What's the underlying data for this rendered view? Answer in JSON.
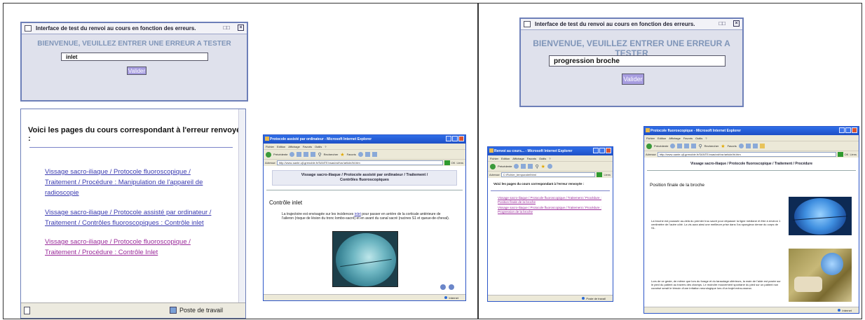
{
  "dialog": {
    "title": "Interface de test du renvoi au cours en fonction des erreurs.",
    "heading": "BIENVENUE, VEUILLEZ ENTRER UNE ERREUR A TESTER",
    "button": "Valider",
    "left_value": "inlet",
    "right_value": "progression broche"
  },
  "results": {
    "heading": "Voici les pages du cours correspondant à l'erreur renvoyée :",
    "links": [
      "Vissage sacro-iliaque / Protocole fluoroscopique / Traitement / Procédure : Manipulation de l'appareil de radioscopie",
      "Vissage sacro-iliaque / Protocole assisté par ordinateur / Traitement / Contrôles fluoroscopiques : Contrôle inlet",
      "Vissage sacro-iliaque / Protocole fluoroscopique / Traitement / Procédure : Contrôle Inlet"
    ],
    "status": "Poste de travail"
  },
  "ie_common": {
    "menu": [
      "Fichier",
      "Edition",
      "Affichage",
      "Favoris",
      "Outils",
      "?"
    ],
    "back": "Précédente",
    "search": "Rechercher",
    "favorites": "Favoris",
    "address_label": "Adresse",
    "go": "OK",
    "links": "Liens",
    "zone": "Internet"
  },
  "ie_inlet": {
    "title": "Protocole assisté par ordinateur - Microsoft Internet Explorer",
    "url": "http://www-sante.ujf-grenoble.fr/SANTE/vsas/vsf/vsr/article/bt.htm",
    "crumb": "Vissage sacro-iliaque / Protocole assisté par ordinateur / Traitement / Contrôles fluoroscopiques",
    "heading": "Contrôle inlet",
    "text_before": "La trajectoire est envisagée sur les incidences ",
    "text_link": "inlet",
    "text_after": " pour passer en arrière de la corticale antérieure de l'aileron (risque de lésion du tronc lombo-sacré) et en avant du canal sacré (racines S1 et queue-de-cheval)."
  },
  "ie_small": {
    "title": "Renvoi au cours... - Microsoft Internet Explorer",
    "url": "C:\\Fichier_temporaire\\html",
    "heading": "Voici les pages du cours correspondant à l'erreur renvoyée :",
    "link": "Vissage sacro-iliaque / Protocole fluoroscopique / Traitement / Procédure : Position finale de la broche",
    "link2": "Vissage sacro-iliaque / Protocole fluoroscopique / Traitement / Procédure : Progression de la broche",
    "status": "Poste de travail"
  },
  "ie_broche": {
    "title": "Protocole fluoroscopique - Microsoft Internet Explorer",
    "url": "http://www-sante.ujf-grenoble.fr/SANTE/vsas/vsf/vsr/article/bt.htm",
    "crumb": "Vissage sacro-iliaque / Protocole fluoroscopique / Traitement / Procédure",
    "heading": "Position finale de la broche",
    "para1": "La broche est poussée au-delà du premier trou sacré pour dépasser la ligne médiane et être à environ 1 centimètre de l'autre côté. La vis aura ainsi une meilleure prise dans l'os spongieux dense du corps de S1.",
    "para2": "Lors de ce geste, de même que lors du forage et du taraudage ultérieurs, la main de l'aide est posée sur le pied du patient au travers des champs. Le moindre mouvement spontané du pied sur un patient non curarisé serait le témoin d'une irritation neurologique lors d'un trajet extra-osseux."
  },
  "colors": {
    "dialog_border": "#6d7fb8",
    "dialog_heading": "#7f95b8",
    "button": "#a79de0",
    "ie_title": "#1d4fc6",
    "link": "#3a3ab0",
    "visited_link": "#9a2a9a"
  }
}
